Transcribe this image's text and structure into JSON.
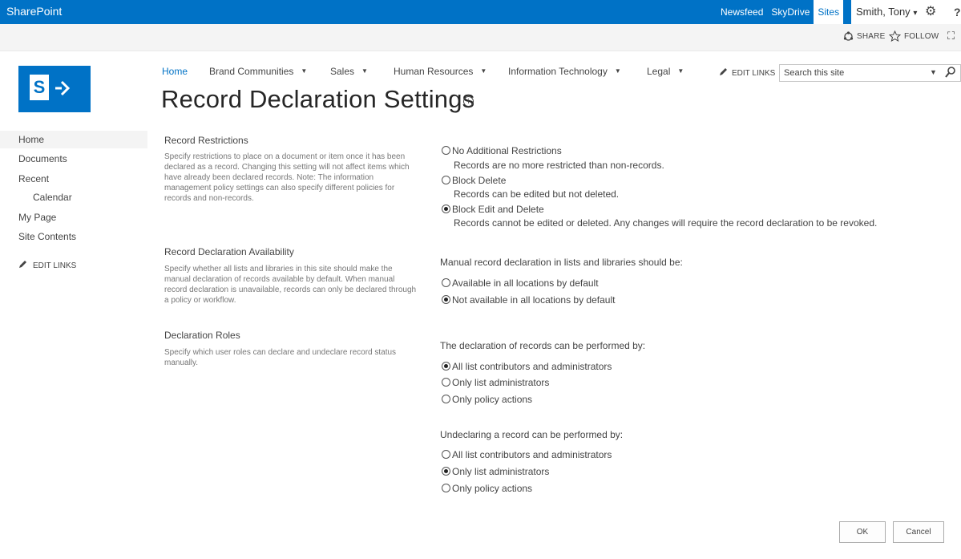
{
  "suitebar": {
    "brand": "SharePoint",
    "links": [
      "Newsfeed",
      "SkyDrive",
      "Sites"
    ],
    "active_link": "Sites",
    "user": "Smith, Tony",
    "user_caret": "▾",
    "gear_icon": "⚙",
    "help_icon": "?"
  },
  "ribbon": {
    "share": "SHARE",
    "follow": "FOLLOW",
    "focus_icon": "⛶"
  },
  "logo": {
    "letter": "S",
    "color": "#0072c6"
  },
  "topnav": {
    "items": [
      "Home",
      "Brand Communities",
      "Sales",
      "Human Resources",
      "Information Technology",
      "Legal"
    ],
    "caret": "▼",
    "edit_links": "EDIT LINKS"
  },
  "search": {
    "placeholder": "Search this site",
    "dropdown": "▼"
  },
  "page": {
    "title": "Record Declaration Settings",
    "info_icon": "i"
  },
  "sidebar": {
    "items": [
      "Home",
      "Documents",
      "Recent",
      "Calendar",
      "My Page",
      "Site Contents"
    ],
    "edit_links": "EDIT LINKS"
  },
  "sections": {
    "restrictions": {
      "heading": "Record Restrictions",
      "description": "Specify restrictions to place on a document or item once it has been declared as a record.  Changing this setting will not affect items which have already been declared records.  Note:  The information management policy settings can also specify different policies for records and non-records.",
      "options": [
        {
          "label": "No Additional Restrictions",
          "desc": "Records are no more restricted than non-records.",
          "selected": false
        },
        {
          "label": "Block Delete",
          "desc": "Records can be edited but not deleted.",
          "selected": false
        },
        {
          "label": "Block Edit and Delete",
          "desc": "Records cannot be edited or deleted. Any changes will require the record declaration to be revoked.",
          "selected": true
        }
      ]
    },
    "availability": {
      "heading": "Record Declaration Availability",
      "description": "Specify whether all lists and libraries in this site should make the manual declaration of records available by default.  When manual record declaration is unavailable, records can only be declared through a policy or workflow.",
      "question": "Manual record declaration in lists and libraries should be:",
      "options": [
        {
          "label": "Available in all locations by default",
          "selected": false
        },
        {
          "label": "Not available in all locations by default",
          "selected": true
        }
      ]
    },
    "roles": {
      "heading": "Declaration Roles",
      "description": "Specify which user roles can declare and undeclare record status manually.",
      "declare_question": "The declaration of records can be performed by:",
      "declare_options": [
        {
          "label": "All list contributors and administrators",
          "selected": true
        },
        {
          "label": "Only list administrators",
          "selected": false
        },
        {
          "label": "Only policy actions",
          "selected": false
        }
      ],
      "undeclare_question": "Undeclaring a record can be performed by:",
      "undeclare_options": [
        {
          "label": "All list contributors and administrators",
          "selected": false
        },
        {
          "label": "Only list administrators",
          "selected": true
        },
        {
          "label": "Only policy actions",
          "selected": false
        }
      ]
    }
  },
  "buttons": {
    "ok": "OK",
    "cancel": "Cancel"
  }
}
